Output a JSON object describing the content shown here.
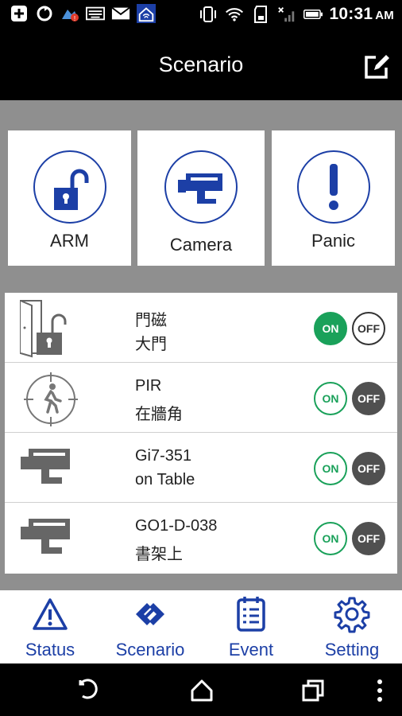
{
  "status_bar": {
    "time": "10:31",
    "ampm": "AM",
    "left_icons": [
      "add-box-icon",
      "sync-icon",
      "weather-alert-icon",
      "keyboard-icon",
      "mail-icon",
      "home-wifi-app-icon"
    ],
    "right_icons": [
      "vibrate-icon",
      "wifi-icon",
      "sd-card-icon",
      "no-signal-icon",
      "battery-icon"
    ]
  },
  "app_bar": {
    "title": "Scenario",
    "edit_icon": "edit-icon"
  },
  "scenario_tiles": [
    {
      "label": "ARM",
      "icon": "unlocked-padlock-icon"
    },
    {
      "label": "Camera",
      "icon": "camera-icon"
    },
    {
      "label": "Panic",
      "icon": "exclamation-icon"
    }
  ],
  "devices": [
    {
      "name": "門磁",
      "location": "大門",
      "icon": "door-sensor-icon",
      "on_label": "ON",
      "off_label": "OFF",
      "state": "on"
    },
    {
      "name": "PIR",
      "location": "在牆角",
      "icon": "motion-sensor-icon",
      "on_label": "ON",
      "off_label": "OFF",
      "state": "off"
    },
    {
      "name": "Gi7-351",
      "location": "on Table",
      "icon": "camera-icon",
      "on_label": "ON",
      "off_label": "OFF",
      "state": "off"
    },
    {
      "name": "GO1-D-038",
      "location": "書架上",
      "icon": "camera-icon",
      "on_label": "ON",
      "off_label": "OFF",
      "state": "off"
    }
  ],
  "bottom_nav": [
    {
      "label": "Status",
      "icon": "warning-icon"
    },
    {
      "label": "Scenario",
      "icon": "scenario-icon"
    },
    {
      "label": "Event",
      "icon": "event-list-icon"
    },
    {
      "label": "Setting",
      "icon": "gear-icon"
    }
  ],
  "colors": {
    "accent_blue": "#1c3fa6",
    "on_green": "#1aa15a",
    "off_gray": "#505050",
    "content_bg": "#8f8f8f"
  }
}
